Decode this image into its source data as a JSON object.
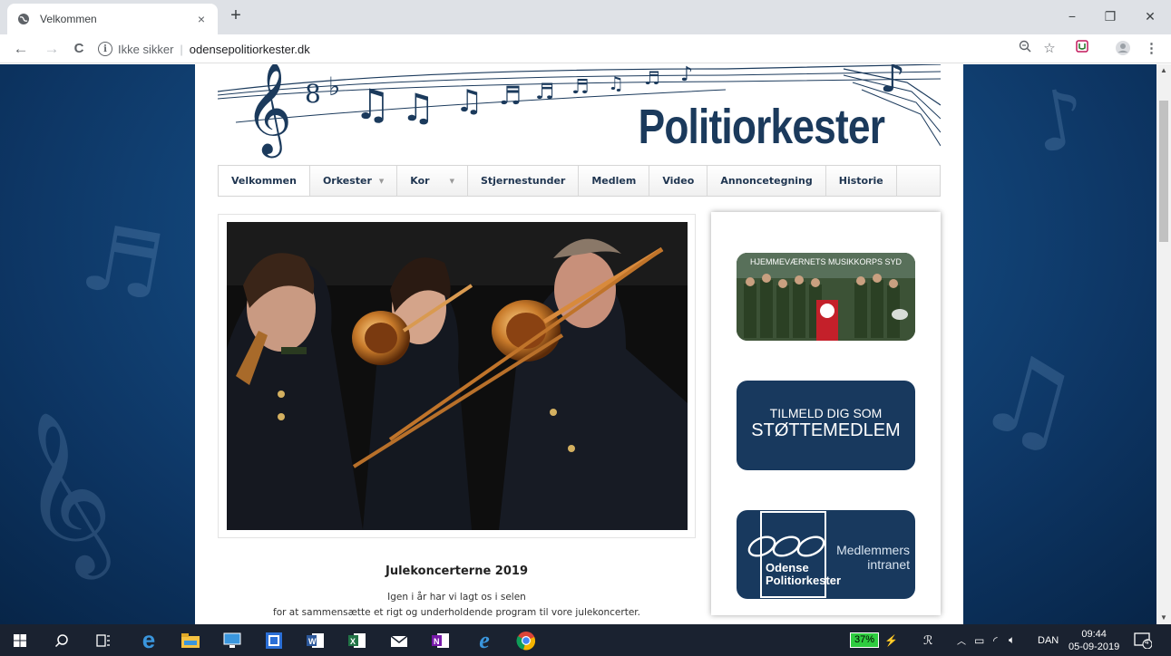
{
  "browser": {
    "tab_title": "Velkommen",
    "tab_close": "×",
    "new_tab": "+",
    "window_controls": {
      "minimize": "−",
      "restore": "❐",
      "close": "✕"
    },
    "nav": {
      "back": "←",
      "forward": "→",
      "reload": "C"
    },
    "security_label": "Ikke sikker",
    "separator": "|",
    "url": "odensepolitiorkester.dk",
    "icons": [
      "zoom-icon",
      "star-icon",
      "extension-icon",
      "profile-icon",
      "menu-icon"
    ]
  },
  "site": {
    "header_title": "Politiorkester",
    "menu": [
      {
        "label": "Velkommen",
        "dropdown": false,
        "active": true
      },
      {
        "label": "Orkester",
        "dropdown": true,
        "active": false
      },
      {
        "label": "Kor",
        "dropdown": true,
        "active": false
      },
      {
        "label": "Stjernestunder",
        "dropdown": false,
        "active": false
      },
      {
        "label": "Medlem",
        "dropdown": false,
        "active": false
      },
      {
        "label": "Video",
        "dropdown": false,
        "active": false
      },
      {
        "label": "Annoncetegning",
        "dropdown": false,
        "active": false
      },
      {
        "label": "Historie",
        "dropdown": false,
        "active": false
      }
    ],
    "menu_caret": "▼",
    "article": {
      "title": "Julekoncerterne 2019",
      "line1": "Igen i år har vi lagt os i selen",
      "line2": "for at sammensætte et rigt og underholdende program til vore julekoncerter."
    },
    "sidebar": {
      "banner1_text": "HJEMMEVÆRNETS MUSIKKORPS SYD",
      "banner2_line1": "TILMELD DIG SOM",
      "banner2_line2": "STØTTEMEDLEM",
      "banner3_logo_line1": "Odense",
      "banner3_logo_line2": "Politiorkester",
      "banner3_right1": "Medlemmers",
      "banner3_right2": "intranet"
    }
  },
  "taskbar": {
    "battery": "37%",
    "language": "DAN",
    "time": "09:44",
    "date": "05-09-2019",
    "notifications": "4"
  },
  "colors": {
    "page_bg": "#144a80",
    "navy": "#18395e",
    "header_text": "#1b3a5c",
    "taskbar": "#1a2230"
  }
}
